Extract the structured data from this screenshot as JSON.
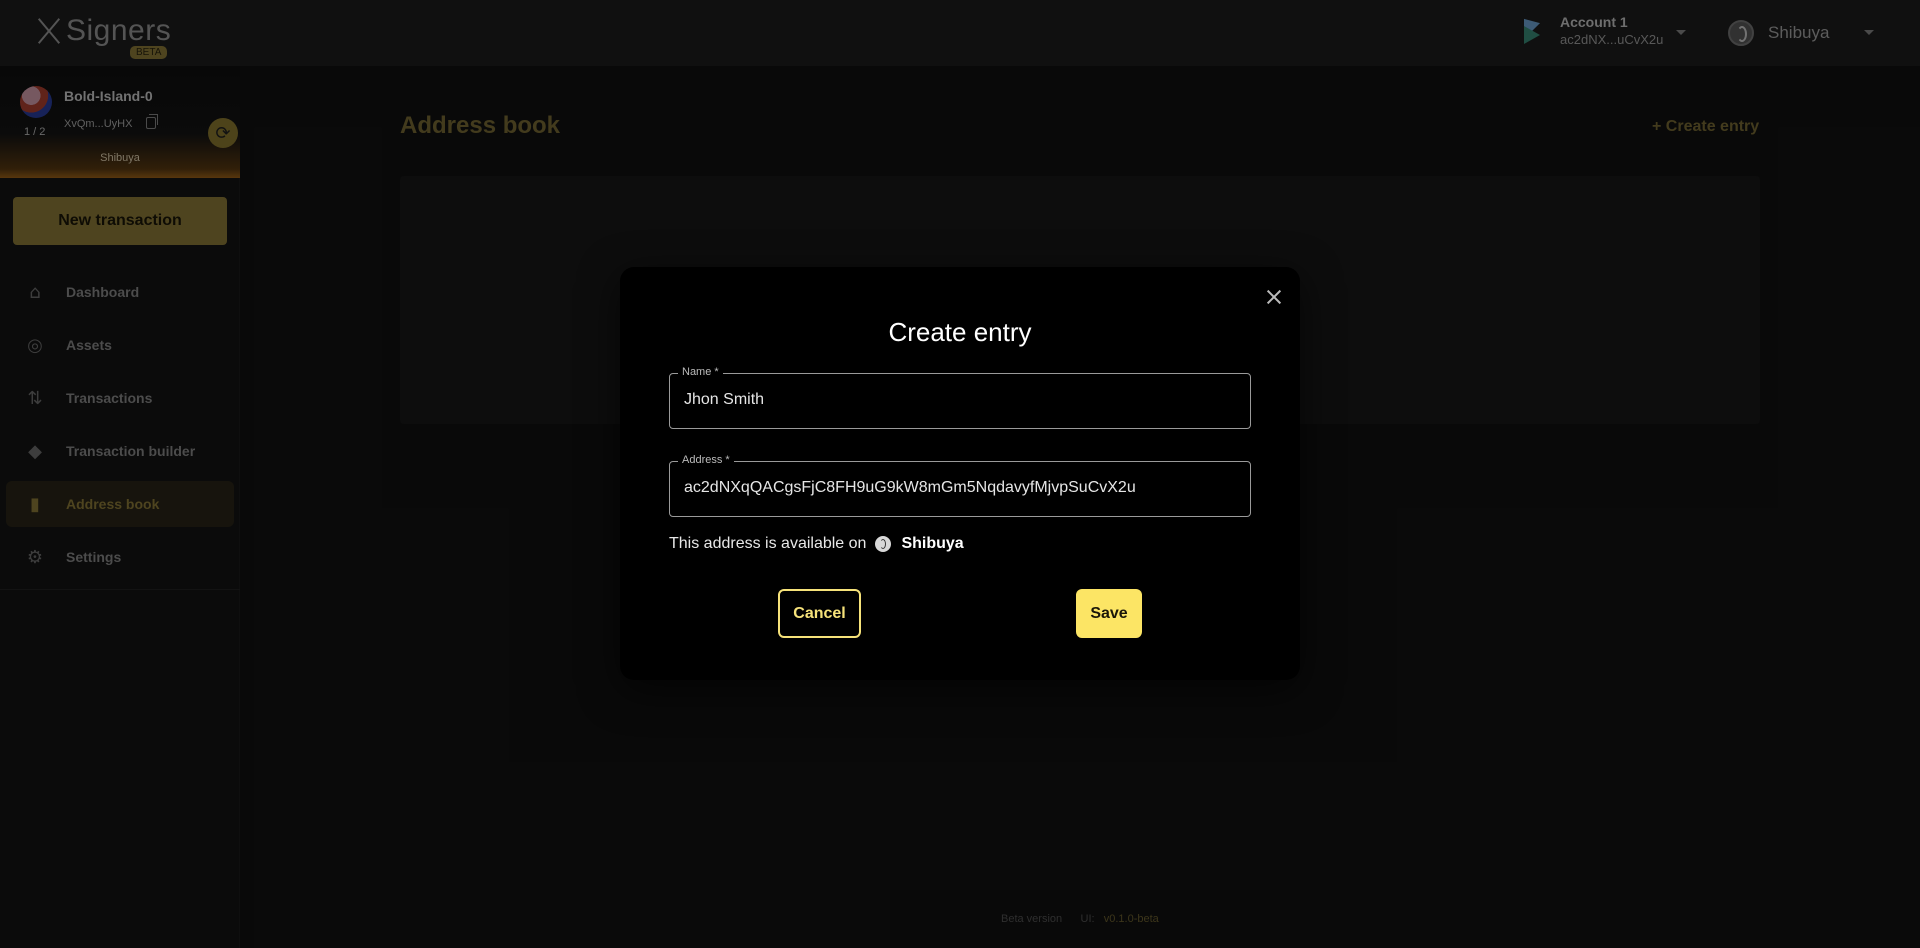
{
  "app": {
    "name": "Signers",
    "badge": "BETA"
  },
  "account": {
    "name": "Account 1",
    "address": "ac2dNX...uCvX2u",
    "icon": "account-icon"
  },
  "network": {
    "name": "Shibuya",
    "icon": "shibuya-icon"
  },
  "wallet": {
    "name": "Bold-Island-0",
    "address": "XvQm...UyHX",
    "count": "1 / 2",
    "network": "Shibuya"
  },
  "sidebar": {
    "new_transaction": "New transaction",
    "items": [
      {
        "label": "Dashboard",
        "icon": "home-icon",
        "active": false
      },
      {
        "label": "Assets",
        "icon": "assets-icon",
        "active": false
      },
      {
        "label": "Transactions",
        "icon": "transactions-icon",
        "active": false
      },
      {
        "label": "Transaction builder",
        "icon": "layers-icon",
        "active": false
      },
      {
        "label": "Address book",
        "icon": "book-icon",
        "active": true
      },
      {
        "label": "Settings",
        "icon": "gear-icon",
        "active": false
      }
    ]
  },
  "main": {
    "title": "Address book",
    "create_entry": "+ Create entry"
  },
  "footer": {
    "beta": "Beta version",
    "ui_label": "UI:",
    "version": "v0.1.0-beta"
  },
  "modal": {
    "title": "Create entry",
    "name_label": "Name *",
    "name_value": "Jhon Smith",
    "address_label": "Address *",
    "address_value": "ac2dNXqQACgsFjC8FH9uG9kW8mGm5NqdavyfMjvpSuCvX2u",
    "available_text": "This address is available on",
    "available_network": "Shibuya",
    "cancel": "Cancel",
    "save": "Save"
  },
  "colors": {
    "accent": "#8f7d3a",
    "save_button": "#fce565",
    "cancel_border": "#f6e27a",
    "background": "#121212"
  }
}
